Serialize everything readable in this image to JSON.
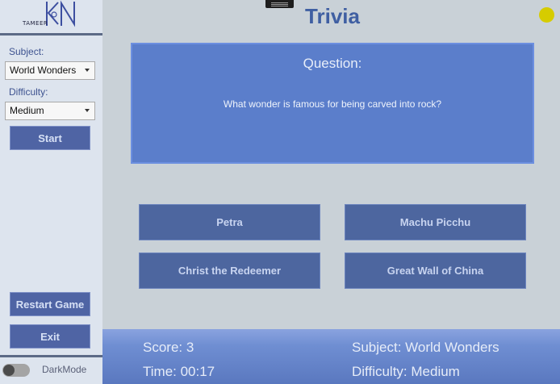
{
  "app": {
    "title": "Trivia",
    "logo_text": "TAMEER"
  },
  "sidebar": {
    "subject_label": "Subject:",
    "subject_value": "World Wonders",
    "difficulty_label": "Difficulty:",
    "difficulty_value": "Medium",
    "start_label": "Start",
    "restart_label": "Restart Game",
    "exit_label": "Exit",
    "darkmode_label": "DarkMode",
    "darkmode_on": false
  },
  "question": {
    "header": "Question:",
    "text": "What wonder is famous for being carved into rock?"
  },
  "answers": [
    "Petra",
    "Machu Picchu",
    "Christ the Redeemer",
    "Great Wall of China"
  ],
  "status": {
    "score": "Score: 3",
    "time": "Time: 00:17",
    "subject": "Subject: World Wonders",
    "difficulty": "Difficulty: Medium"
  },
  "colors": {
    "accent": "#4f64a4",
    "question_bg": "#5b7ecb",
    "indicator": "#d6cc00"
  }
}
